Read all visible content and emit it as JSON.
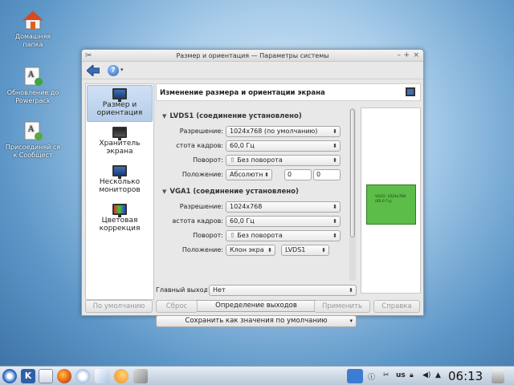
{
  "desktop": {
    "icons": [
      {
        "label": "Домашняя папка",
        "icon": "home-icon"
      },
      {
        "label": "Обновление до Powerpack",
        "icon": "update-icon"
      },
      {
        "label": "Присоединяй ся к Сообщест",
        "icon": "join-community-icon"
      }
    ]
  },
  "window": {
    "title": "Размер и ориентация — Параметры системы",
    "controls": {
      "menu": "–",
      "keep_above": "+",
      "close": "×"
    },
    "sidebar": [
      {
        "label": "Размер и ориентация",
        "active": true
      },
      {
        "label": "Хранитель экрана",
        "active": false
      },
      {
        "label": "Несколько мониторов",
        "active": false
      },
      {
        "label": "Цветовая коррекция",
        "active": false
      }
    ],
    "header_title": "Изменение размера и ориентации экрана",
    "outputs": [
      {
        "heading": "LVDS1 (соединение установлено)",
        "resolution_label": "Разрешение:",
        "resolution_value": "1024x768 (по умолчанию)",
        "refresh_label": "стота кадров:",
        "refresh_value": "60,0 Гц",
        "rotation_label": "Поворот:",
        "rotation_value": "Без поворота",
        "position_label": "Положение:",
        "position_mode": "Абсолютн",
        "position_x": "0",
        "position_y": "0"
      },
      {
        "heading": "VGA1 (соединение установлено)",
        "resolution_label": "Разрешение:",
        "resolution_value": "1024x768",
        "refresh_label": "астота кадров:",
        "refresh_value": "60,0 Гц",
        "rotation_label": "Поворот:",
        "rotation_value": "Без поворота",
        "position_label": "Положение:",
        "position_mode": "Клон экра",
        "position_target": "LVDS1"
      }
    ],
    "primary_label": "Главный выход",
    "primary_value": "Нет",
    "identify_button": "Определение выходов",
    "save_default_button": "Сохранить как значения по умолчанию",
    "preview_text": "VGA1: 1024x768 (60.0 Гц)",
    "buttons": {
      "defaults": "По умолчанию",
      "reset": "Сброс",
      "apply": "Применить",
      "help": "Справка"
    }
  },
  "taskbar": {
    "clock": "06:13",
    "keyboard_layout": "us"
  },
  "colors": {
    "accent": "#3d6fb6",
    "preview_output": "#5cbd48",
    "selection": "#b4cde9"
  }
}
